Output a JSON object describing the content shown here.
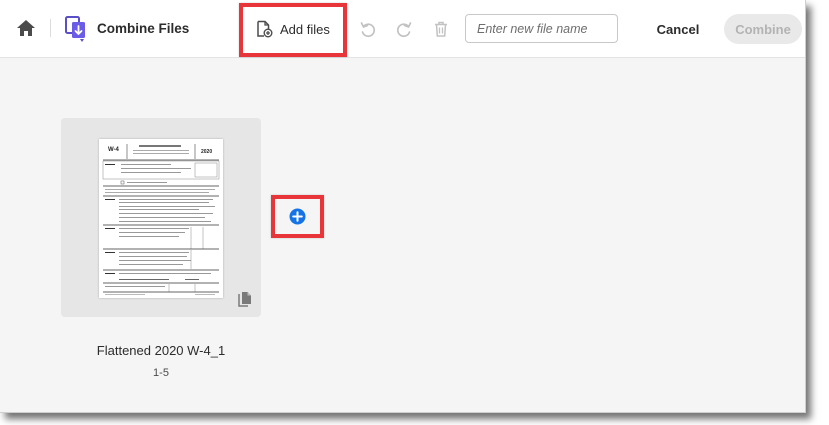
{
  "toolbar": {
    "home_icon": "home-icon",
    "app_icon": "combine-files-icon",
    "title": "Combine Files",
    "add_files_icon": "add-file-icon",
    "add_files_label": "Add files",
    "undo_icon": "undo-icon",
    "redo_icon": "redo-icon",
    "delete_icon": "trash-icon",
    "file_name_placeholder": "Enter new file name",
    "cancel_label": "Cancel",
    "combine_label": "Combine"
  },
  "files": [
    {
      "name": "Flattened 2020 W-4_1",
      "pages": "1-5",
      "thumbnail_title": "W-4",
      "thumbnail_year": "2020",
      "type_icon": "document-icon"
    }
  ],
  "insert_icon": "add-circle-icon",
  "colors": {
    "highlight": "#e8353a",
    "insert_button": "#1473e6",
    "combine_disabled_bg": "#e9e9e9"
  }
}
